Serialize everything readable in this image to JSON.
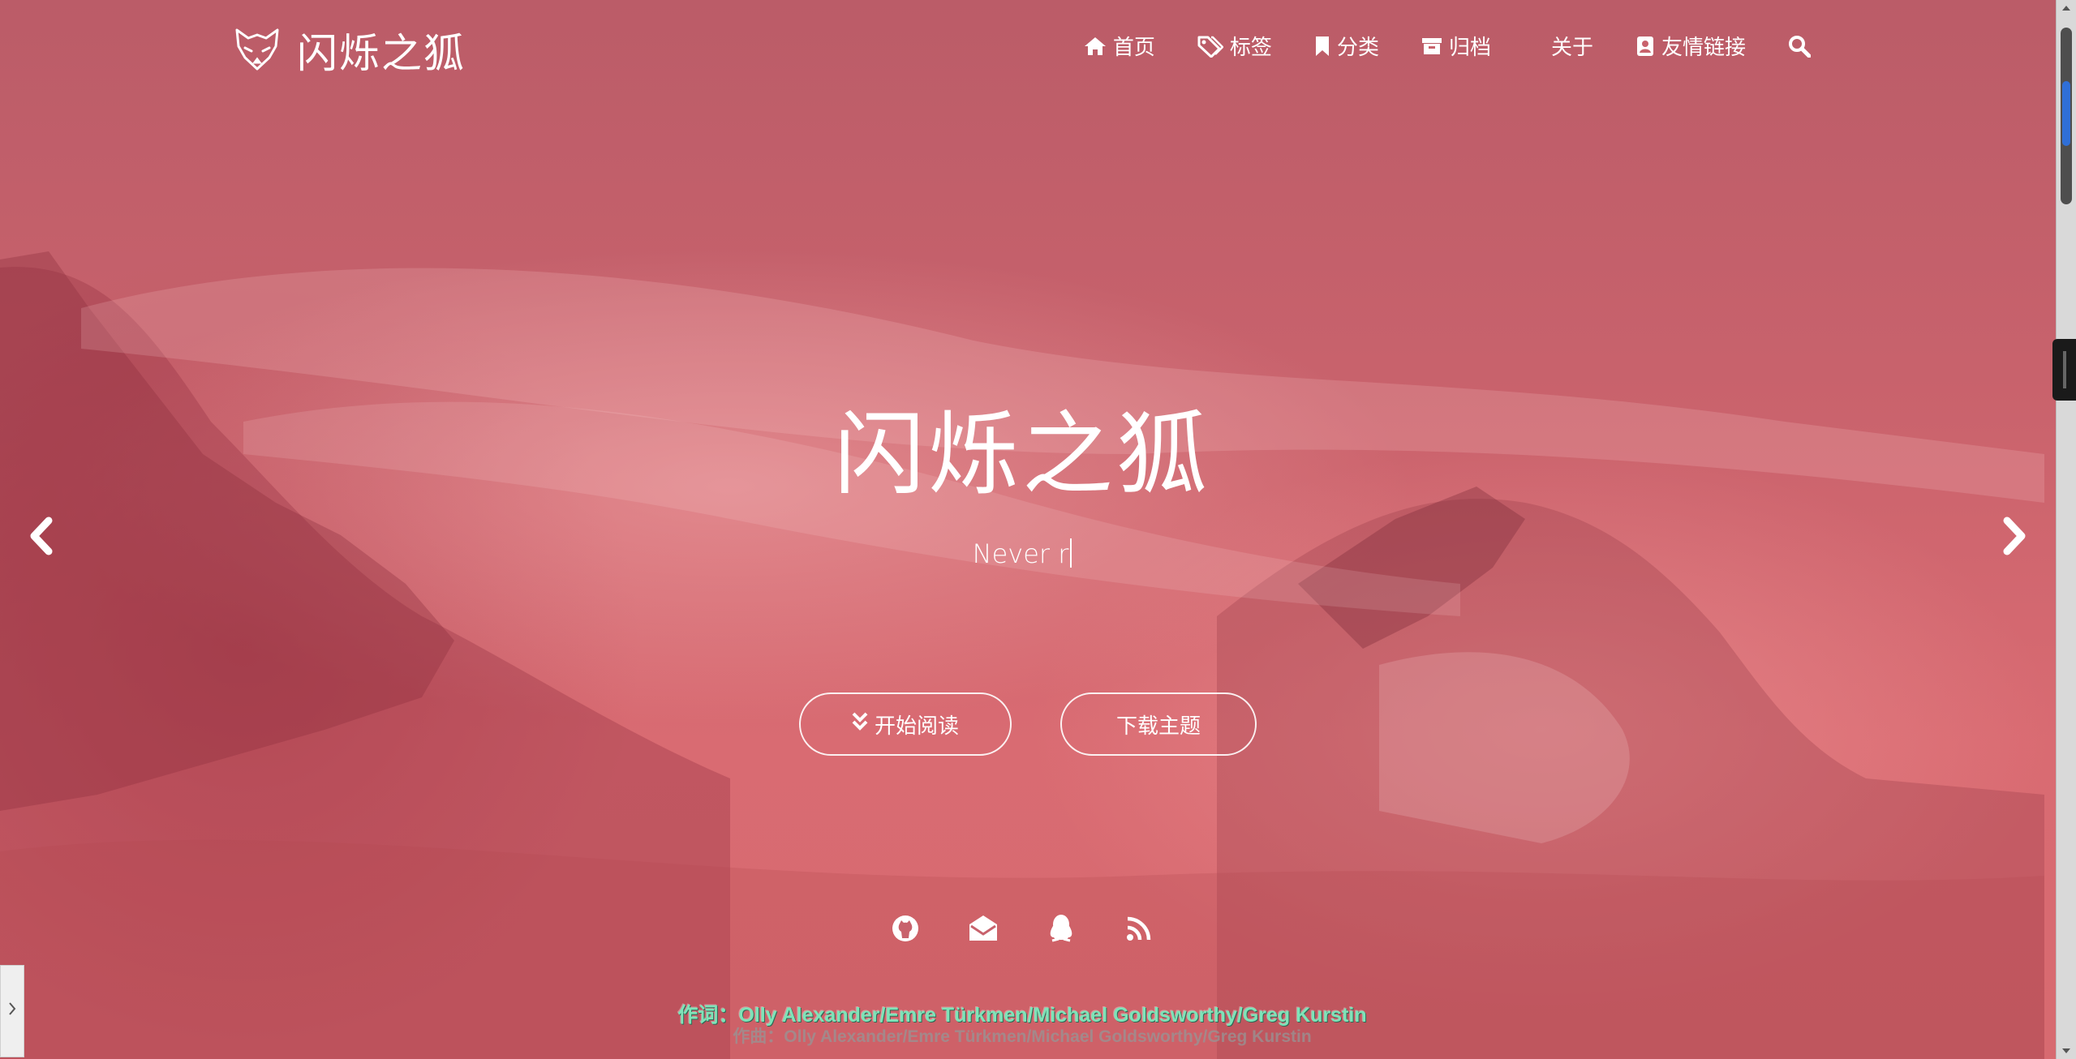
{
  "site": {
    "logo_icon": "fox-icon",
    "title": "闪烁之狐"
  },
  "nav": {
    "items": [
      {
        "label": "首页",
        "icon": "home-icon"
      },
      {
        "label": "标签",
        "icon": "tags-icon"
      },
      {
        "label": "分类",
        "icon": "bookmark-icon"
      },
      {
        "label": "归档",
        "icon": "archive-icon"
      },
      {
        "label": "关于",
        "icon": "user-icon"
      },
      {
        "label": "友情链接",
        "icon": "address-book-icon"
      }
    ],
    "search_icon": "search-icon"
  },
  "hero": {
    "title": "闪烁之狐",
    "subtitle": "Never r",
    "read_button": "开始阅读",
    "download_button": "下载主题",
    "prev_icon": "chevron-left-icon",
    "next_icon": "chevron-right-icon"
  },
  "social": [
    {
      "icon": "github-icon"
    },
    {
      "icon": "envelope-open-icon"
    },
    {
      "icon": "qq-icon"
    },
    {
      "icon": "rss-icon"
    }
  ],
  "lyrics": {
    "main": "作词：Olly Alexander/Emre Türkmen/Michael Goldsworthy/Greg Kurstin",
    "ghost": "作曲：Olly Alexander/Emre Türkmen/Michael Goldsworthy/Greg Kurstin"
  },
  "colors": {
    "overlay": "#c8626c",
    "lyric": "#7fe3b8",
    "scroll_accent": "#2f6fd8"
  }
}
